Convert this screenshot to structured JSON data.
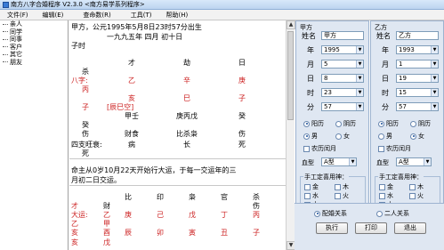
{
  "window": {
    "title": "南方八字合婚程序 V2.3.0    <南方易学系列程序>"
  },
  "menu": [
    "文件(F)",
    "编辑(E)",
    "查命数(R)",
    "工具(T)",
    "帮助(H)"
  ],
  "sidebar": {
    "items": [
      "亲人",
      "同学",
      "同事",
      "客户",
      "其它",
      "朋友"
    ]
  },
  "main": {
    "header_line1": "甲方，公元1995年5月8日23时57分出生",
    "header_line2": "一九九五年      四月      初十日",
    "header_line3": "子时",
    "shishen": [
      "才",
      "劫",
      "日"
    ],
    "bazi_label": "八字:",
    "gan": [
      "乙",
      "辛",
      "庚"
    ],
    "gan_extra": "丙",
    "zhi_left": "子",
    "zhi": [
      "亥",
      "巳",
      "子"
    ],
    "kongwang": "[辰巳空]",
    "cang_label": "癸",
    "cang": [
      "甲壬",
      "庚丙戊",
      "癸"
    ],
    "cang2": [
      "财食",
      "比杀枭",
      "伤"
    ],
    "cang2_left": "伤",
    "changsheng_label": "四支旺衰:",
    "changsheng": [
      "病",
      "长",
      "死"
    ],
    "changsheng_last": "死",
    "dayun_text1": "命主从0岁10月22天开始行大运，于每一交运年的三",
    "dayun_text2": "月初二日交运。",
    "dayun_shishen": [
      "比",
      "印",
      "枭",
      "官",
      "杀"
    ],
    "dayun_row1_left": "才",
    "dayun_row1_mid": "财",
    "dayun_row1_right": "伤",
    "dayun_label": "大运:",
    "dayun_gan": [
      "庚",
      "己",
      "戊",
      "丁",
      "丙"
    ],
    "dayun_gan_left": "乙",
    "dayun_row2_left": "乙",
    "dayun_row2_mid": "甲",
    "dayun_zhi_left": "亥",
    "dayun_zhi": [
      "辰",
      "卯",
      "寅",
      "丑",
      "子"
    ],
    "dayun_zhi_mid": "酉",
    "dayun_row4_left": "亥",
    "dayun_row4_mid": "戊"
  },
  "party_a": {
    "title": "甲方",
    "name_label": "姓名",
    "name_value": "甲方",
    "year_label": "年",
    "year_value": "1995",
    "month_label": "月",
    "month_value": "5",
    "day_label": "日",
    "day_value": "8",
    "hour_label": "时",
    "hour_value": "23",
    "minute_label": "分",
    "minute_value": "57",
    "solar_label": "阳历",
    "lunar_label": "阴历",
    "male_label": "男",
    "female_label": "女",
    "leap_label": "农历闰月",
    "blood_label": "血型",
    "blood_value": "A型",
    "group_label": "手工定喜用神：",
    "elements": [
      "金",
      "木",
      "水",
      "火",
      "土"
    ]
  },
  "party_b": {
    "title": "乙方",
    "name_label": "姓名",
    "name_value": "乙方",
    "year_label": "年",
    "year_value": "1993",
    "month_label": "月",
    "month_value": "1",
    "day_label": "日",
    "day_value": "19",
    "hour_label": "时",
    "hour_value": "15",
    "minute_label": "分",
    "minute_value": "57",
    "solar_label": "阳历",
    "lunar_label": "阴历",
    "male_label": "男",
    "female_label": "女",
    "leap_label": "农历闰月",
    "blood_label": "血型",
    "blood_value": "A型",
    "group_label": "手工定喜用神：",
    "elements": [
      "金",
      "木",
      "水",
      "火",
      "土"
    ]
  },
  "relation": {
    "option1": "配婚关系",
    "option2": "二人关系"
  },
  "buttons": {
    "execute": "执行",
    "print": "打印",
    "exit": "退出"
  },
  "colors": {
    "panel_bg": "#dfe7f2",
    "accent_red": "#cc2020"
  }
}
